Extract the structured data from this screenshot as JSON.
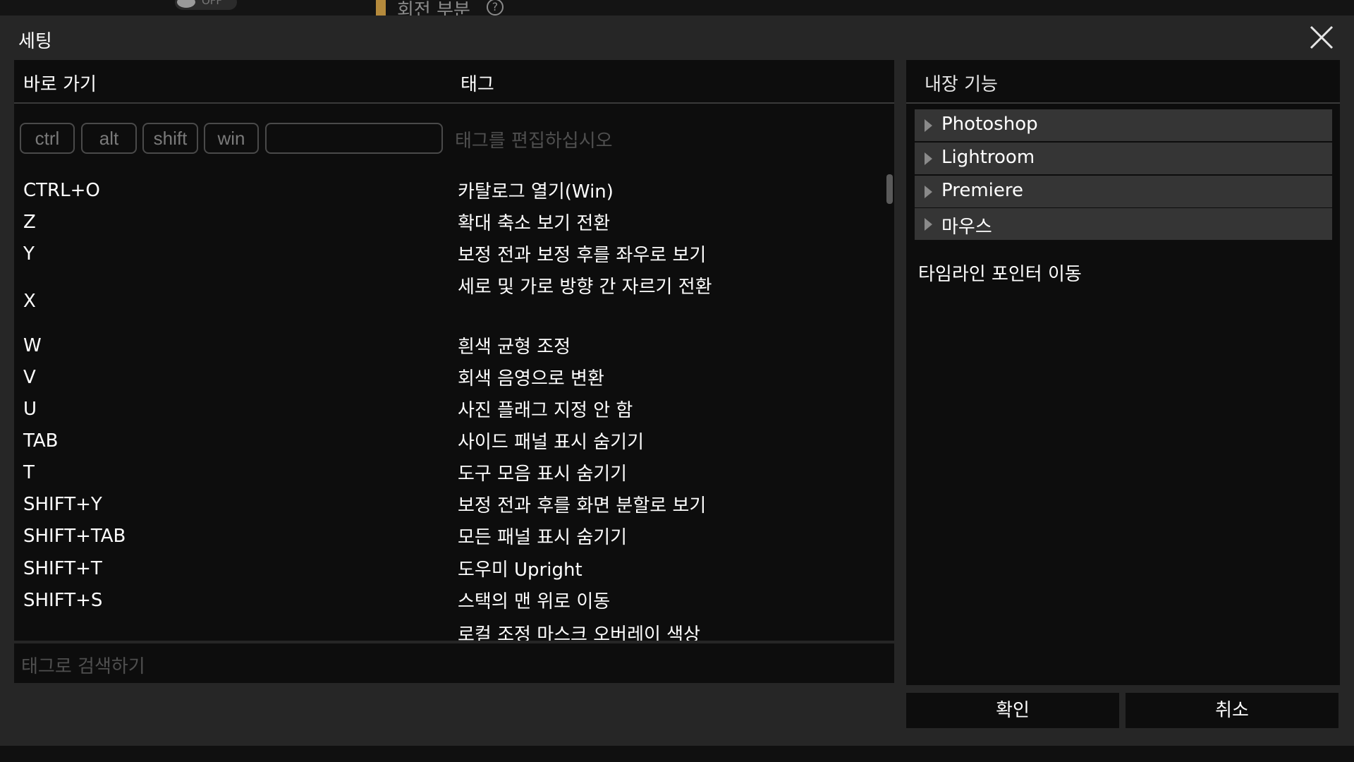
{
  "background": {
    "toggle_label": "OFF",
    "caption": "회전 부분",
    "help_label": "?"
  },
  "dialog": {
    "title": "세팅",
    "close_icon": "close-icon"
  },
  "shortcuts": {
    "col_key": "바로 가기",
    "col_tag": "태그",
    "modifiers": [
      "ctrl",
      "alt",
      "shift",
      "win"
    ],
    "tag_edit_placeholder": "태그를 편집하십시오",
    "rows": [
      {
        "key": "CTRL+O",
        "tag": "카탈로그 열기(Win)"
      },
      {
        "key": "Z",
        "tag": "확대 축소 보기 전환"
      },
      {
        "key": "Y",
        "tag": "보정 전과 보정 후를 좌우로 보기"
      },
      {
        "key": "X",
        "tag": "세로 및 가로 방향 간 자르기 전환"
      },
      {
        "key": "W",
        "tag": "흰색 균형 조정"
      },
      {
        "key": "V",
        "tag": "회색 음영으로 변환"
      },
      {
        "key": "U",
        "tag": "사진 플래그 지정 안 함"
      },
      {
        "key": "TAB",
        "tag": "사이드 패널 표시 숨기기"
      },
      {
        "key": "T",
        "tag": "도구 모음 표시 숨기기"
      },
      {
        "key": "SHIFT+Y",
        "tag": "보정 전과 후를 화면 분할로 보기"
      },
      {
        "key": "SHIFT+TAB",
        "tag": "모든 패널 표시 숨기기"
      },
      {
        "key": "SHIFT+T",
        "tag": "도우미 Upright"
      },
      {
        "key": "SHIFT+S",
        "tag": "스택의 맨 위로 이동"
      },
      {
        "key": "",
        "tag": "로컬 조정 마스크 오버레이 색상"
      }
    ],
    "search_placeholder": "태그로 검색하기"
  },
  "builtin": {
    "header": "내장 기능",
    "groups": [
      "Photoshop",
      "Lightroom",
      "Premiere",
      "마우스"
    ],
    "items": [
      "타임라인 포인터 이동"
    ]
  },
  "footer": {
    "ok_label": "확인",
    "cancel_label": "취소"
  }
}
